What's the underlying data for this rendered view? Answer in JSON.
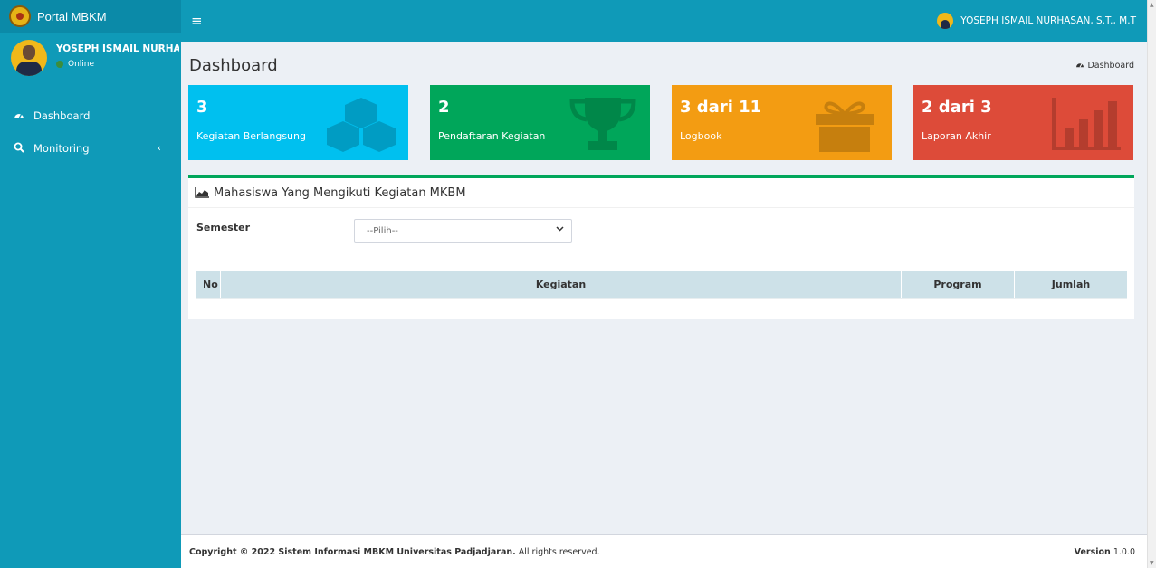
{
  "app": {
    "brand": "Portal MBKM"
  },
  "user": {
    "name": "YOSEPH ISMAIL NURHASAN",
    "status": "Online",
    "topbar_name": "YOSEPH ISMAIL NURHASAN, S.T., M.T"
  },
  "sidebar": {
    "items": [
      {
        "label": "Dashboard",
        "icon": "dashboard-icon"
      },
      {
        "label": "Monitoring",
        "icon": "search-icon"
      }
    ]
  },
  "page": {
    "title": "Dashboard",
    "breadcrumb": "Dashboard"
  },
  "boxes": [
    {
      "number": "3",
      "label": "Kegiatan Berlangsung",
      "color": "#00c0ef",
      "icon": "cubes-icon"
    },
    {
      "number": "2",
      "label": "Pendaftaran Kegiatan",
      "color": "#00a65a",
      "icon": "trophy-icon"
    },
    {
      "number": "3 dari 11",
      "label": "Logbook",
      "color": "#f39c12",
      "icon": "gift-icon"
    },
    {
      "number": "2 dari 3",
      "label": "Laporan Akhir",
      "color": "#dd4b39",
      "icon": "bar-chart-icon"
    }
  ],
  "panel": {
    "title": "Mahasiswa Yang Mengikuti Kegiatan MKBM",
    "filter_label": "Semester",
    "select_value": "--Pilih--",
    "columns": [
      "No",
      "Kegiatan",
      "Program",
      "Jumlah"
    ]
  },
  "footer": {
    "copyright_bold": "Copyright © 2022 Sistem Informasi MBKM Universitas Padjadjaran.",
    "copyright_rest": " All rights reserved.",
    "version_label": "Version",
    "version_value": "1.0.0"
  }
}
